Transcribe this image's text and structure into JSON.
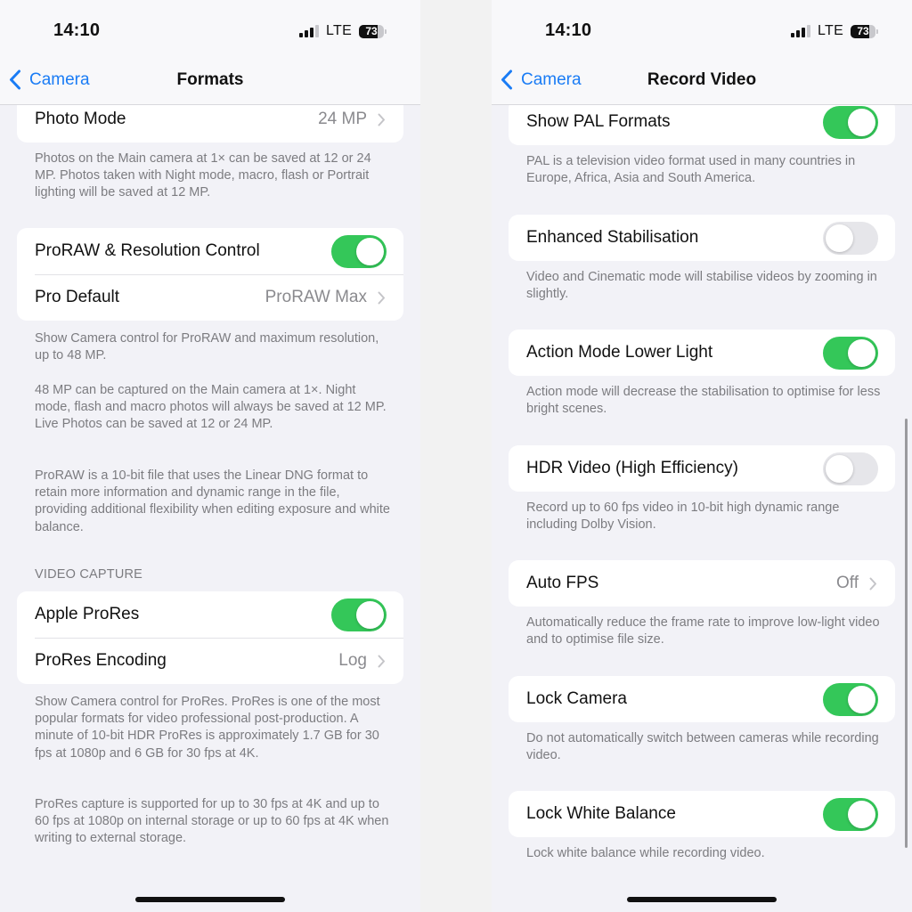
{
  "status_bar": {
    "time": "14:10",
    "network": "LTE",
    "battery_percent": "73",
    "battery_level": 0.73,
    "signal_bars": 3,
    "signal_bars_total": 4
  },
  "left": {
    "nav": {
      "back_label": "Camera",
      "title": "Formats"
    },
    "photo_mode": {
      "label": "Photo Mode",
      "value": "24 MP"
    },
    "photo_mode_footer": "Photos on the Main camera at 1× can be saved at 12 or 24 MP. Photos taken with Night mode, macro, flash or Portrait lighting will be saved at 12 MP.",
    "proraw": {
      "label": "ProRAW & Resolution Control",
      "on": true
    },
    "pro_default": {
      "label": "Pro Default",
      "value": "ProRAW Max"
    },
    "proraw_footer_1": "Show Camera control for ProRAW and maximum resolution, up to 48 MP.",
    "proraw_footer_2": "48 MP can be captured on the Main camera at 1×. Night mode, flash and macro photos will always be saved at 12 MP. Live Photos can be saved at 12 or 24 MP.",
    "proraw_footer_3": "ProRAW is a 10-bit file that uses the Linear DNG format to retain more information and dynamic range in the file, providing additional flexibility when editing exposure and white balance.",
    "video_capture_header": "VIDEO CAPTURE",
    "apple_prores": {
      "label": "Apple ProRes",
      "on": true
    },
    "prores_encoding": {
      "label": "ProRes Encoding",
      "value": "Log"
    },
    "prores_footer_1": "Show Camera control for ProRes. ProRes is one of the most popular formats for video professional post-production. A minute of 10-bit HDR ProRes is approximately 1.7 GB for 30 fps at 1080p and 6 GB for 30 fps at 4K.",
    "prores_footer_2": "ProRes capture is supported for up to 30 fps at 4K and up to 60 fps at 1080p on internal storage or up to 60 fps at 4K when writing to external storage."
  },
  "right": {
    "nav": {
      "back_label": "Camera",
      "title": "Record Video"
    },
    "settings": [
      {
        "label": "Show PAL Formats",
        "type": "toggle",
        "on": true,
        "footer": "PAL is a television video format used in many countries in Europe, Africa, Asia and South America."
      },
      {
        "label": "Enhanced Stabilisation",
        "type": "toggle",
        "on": false,
        "footer": "Video and Cinematic mode will stabilise videos by zooming in slightly."
      },
      {
        "label": "Action Mode Lower Light",
        "type": "toggle",
        "on": true,
        "footer": "Action mode will decrease the stabilisation to optimise for less bright scenes."
      },
      {
        "label": "HDR Video (High Efficiency)",
        "type": "toggle",
        "on": false,
        "footer": "Record up to 60 fps video in 10-bit high dynamic range including Dolby Vision."
      },
      {
        "label": "Auto FPS",
        "type": "disclosure",
        "value": "Off",
        "footer": "Automatically reduce the frame rate to improve low-light video and to optimise file size."
      },
      {
        "label": "Lock Camera",
        "type": "toggle",
        "on": true,
        "footer": "Do not automatically switch between cameras while recording video."
      },
      {
        "label": "Lock White Balance",
        "type": "toggle",
        "on": true,
        "footer": "Lock white balance while recording video."
      }
    ]
  },
  "colors": {
    "accent": "#1a7cf5",
    "toggle_on": "#34c759",
    "toggle_off": "#e6e6ea",
    "background": "#f2f2f7"
  }
}
